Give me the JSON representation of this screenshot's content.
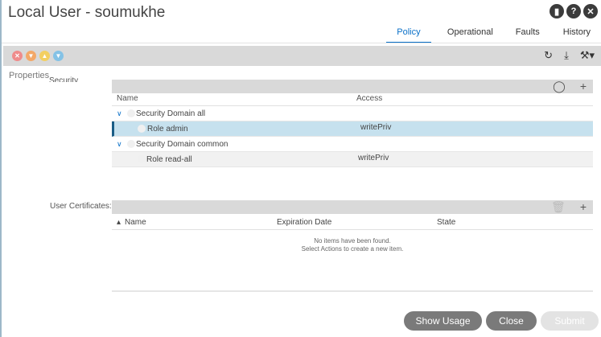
{
  "window": {
    "title": "Local User - soumukhe",
    "header_icons": [
      "bookmark-icon",
      "help-icon",
      "close-icon"
    ]
  },
  "tabs": [
    {
      "label": "Policy",
      "active": true
    },
    {
      "label": "Operational",
      "active": false
    },
    {
      "label": "Faults",
      "active": false
    },
    {
      "label": "History",
      "active": false
    }
  ],
  "toolbar": {
    "fault_icons": [
      "critical-fault-icon",
      "major-fault-icon",
      "minor-fault-icon",
      "warning-fault-icon"
    ],
    "right_icons": [
      "refresh-icon",
      "download-icon",
      "tools-icon"
    ]
  },
  "properties_label": "Properties",
  "security_domains": {
    "label": "Security Domains:",
    "columns": [
      "Name",
      "Access"
    ],
    "rows": [
      {
        "type": "domain",
        "name": "Security Domain all",
        "access": ""
      },
      {
        "type": "role",
        "name": "Role admin",
        "access": "writePriv",
        "selected": true
      },
      {
        "type": "domain",
        "name": "Security Domain common",
        "access": ""
      },
      {
        "type": "role",
        "name": "Role read-all",
        "access": "writePriv",
        "selected": false
      }
    ]
  },
  "user_certificates": {
    "label": "User Certificates:",
    "columns": [
      "Name",
      "Expiration Date",
      "State"
    ],
    "empty_line1": "No items have been found.",
    "empty_line2": "Select Actions to create a new item."
  },
  "buttons": {
    "show_usage": "Show Usage",
    "close": "Close",
    "submit": "Submit"
  },
  "colors": {
    "accent": "#0a70c8",
    "selected_row": "#c6e1ee",
    "toolbar_bg": "#d9d9d9",
    "button_bg": "#7a7a7a"
  }
}
